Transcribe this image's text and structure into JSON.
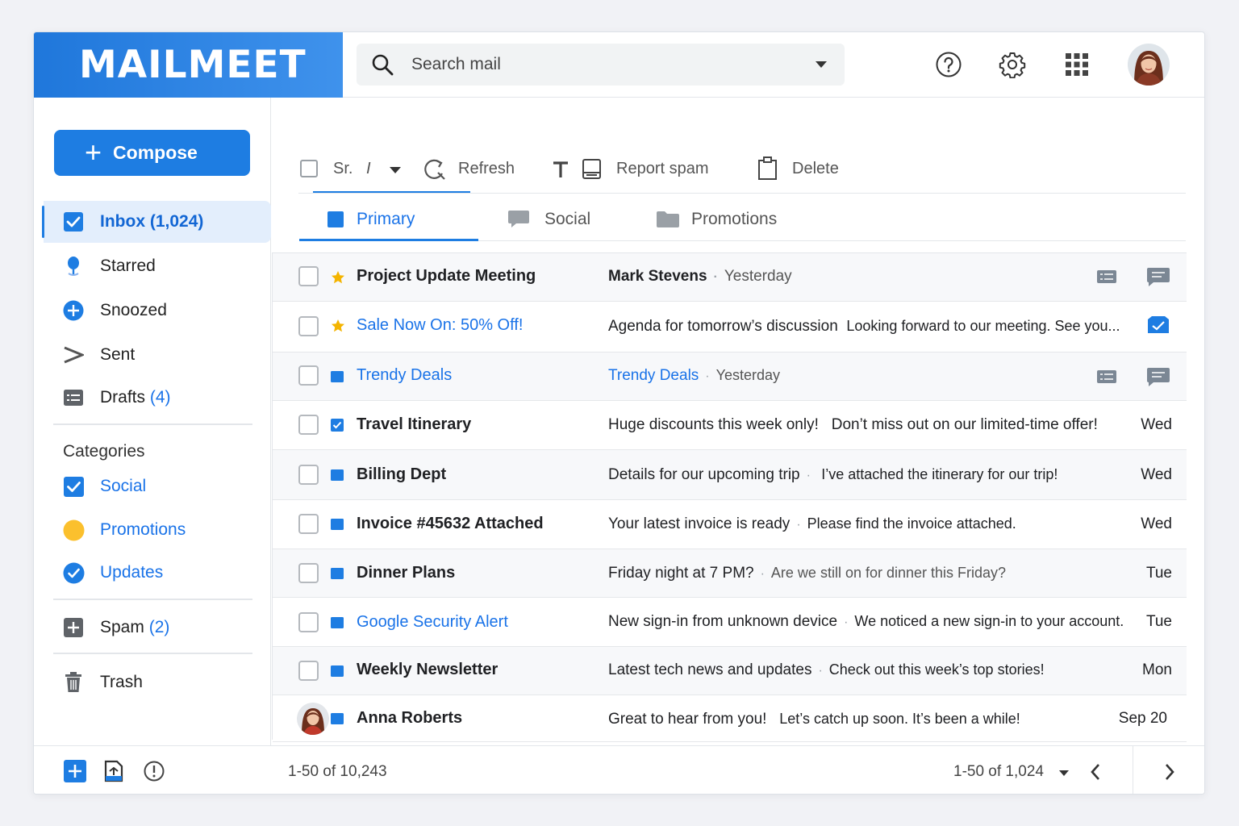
{
  "app": {
    "logo": "MAILMEET"
  },
  "search": {
    "placeholder": "Search mail"
  },
  "colors": {
    "accent": "#1e7de2",
    "link": "#1a73e8",
    "star": "#f4b400",
    "promotions": "#fbc02d"
  },
  "compose": {
    "label": "Compose",
    "icon": "plus-icon"
  },
  "nav": {
    "inbox": {
      "label": "Inbox",
      "count": "(1,024)"
    },
    "starred": {
      "label": "Starred"
    },
    "snoozed": {
      "label": "Snoozed"
    },
    "sent": {
      "label": "Sent"
    },
    "drafts": {
      "label": "Drafts",
      "count": "(4)"
    },
    "spam": {
      "label": "Spam",
      "count": "(2)"
    },
    "trash": {
      "label": "Trash"
    }
  },
  "categories": {
    "heading": "Categories",
    "social": "Social",
    "promotions": "Promotions",
    "updates": "Updates"
  },
  "toolbar": {
    "select_label": "Sr.",
    "sort_label": "I",
    "refresh": "Refresh",
    "report_spam": "Report spam",
    "delete": "Delete"
  },
  "tabs": {
    "primary": "Primary",
    "social": "Social",
    "promotions": "Promotions"
  },
  "emails": [
    {
      "sender": "Project Update Meeting",
      "subject": "Mark Stevens",
      "snippet": "",
      "date": "Yesterday"
    },
    {
      "sender": "Sale Now On: 50% Off!",
      "subject": "Agenda for tomorrow’s discussion",
      "snippet": "Looking forward to our meeting. See you...",
      "date": ""
    },
    {
      "sender": "Trendy Deals",
      "subject": "Trendy Deals",
      "snippet": "",
      "date": "Yesterday"
    },
    {
      "sender": "Travel Itinerary",
      "subject": "Huge discounts this week only!",
      "snippet": "Don’t miss out on our limited-time offer!",
      "date": "Wed"
    },
    {
      "sender": "Billing Dept",
      "subject": "Details for our upcoming trip",
      "snippet": "I’ve attached the itinerary for our trip!",
      "date": "Wed"
    },
    {
      "sender": "Invoice #45632 Attached",
      "subject": "Your latest invoice is ready",
      "snippet": "Please find the invoice attached.",
      "date": "Wed"
    },
    {
      "sender": "Dinner Plans",
      "subject": "Friday night at 7 PM?",
      "snippet": "Are we still on for dinner this Friday?",
      "date": "Tue"
    },
    {
      "sender": "Google Security Alert",
      "subject": "New sign-in from unknown device",
      "snippet": "We noticed a new sign-in to your account.",
      "date": "Tue"
    },
    {
      "sender": "Weekly Newsletter",
      "subject": "Latest tech news and updates",
      "snippet": "Check out this week’s top stories!",
      "date": "Mon"
    },
    {
      "sender": "Anna Roberts",
      "subject": "Great to hear from you!",
      "snippet": "Let’s catch up soon. It’s been a while!",
      "date": "Sep 20"
    }
  ],
  "footer": {
    "range_left": "1-50 of 10,243",
    "range_right": "1-50 of 1,024"
  }
}
